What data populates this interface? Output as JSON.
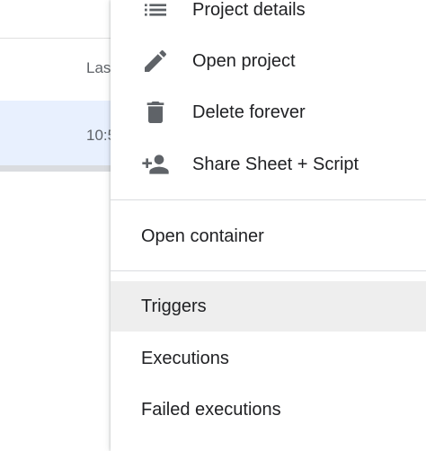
{
  "background": {
    "header_partial": "Las",
    "row_time_partial": "10:5"
  },
  "menu": {
    "items": [
      {
        "label": "Project details",
        "icon": "list-icon"
      },
      {
        "label": "Open project",
        "icon": "pencil-icon"
      },
      {
        "label": "Delete forever",
        "icon": "trash-icon"
      },
      {
        "label": "Share Sheet + Script",
        "icon": "person-add-icon"
      }
    ],
    "secondary_items": [
      {
        "label": "Open container"
      }
    ],
    "tertiary_items": [
      {
        "label": "Triggers",
        "highlighted": true
      },
      {
        "label": "Executions"
      },
      {
        "label": "Failed executions"
      }
    ]
  },
  "colors": {
    "selected_row": "#e8f0fe",
    "hover_item": "#eeeeee",
    "icon": "#5f6368",
    "text": "#202124",
    "divider": "#dadce0"
  }
}
